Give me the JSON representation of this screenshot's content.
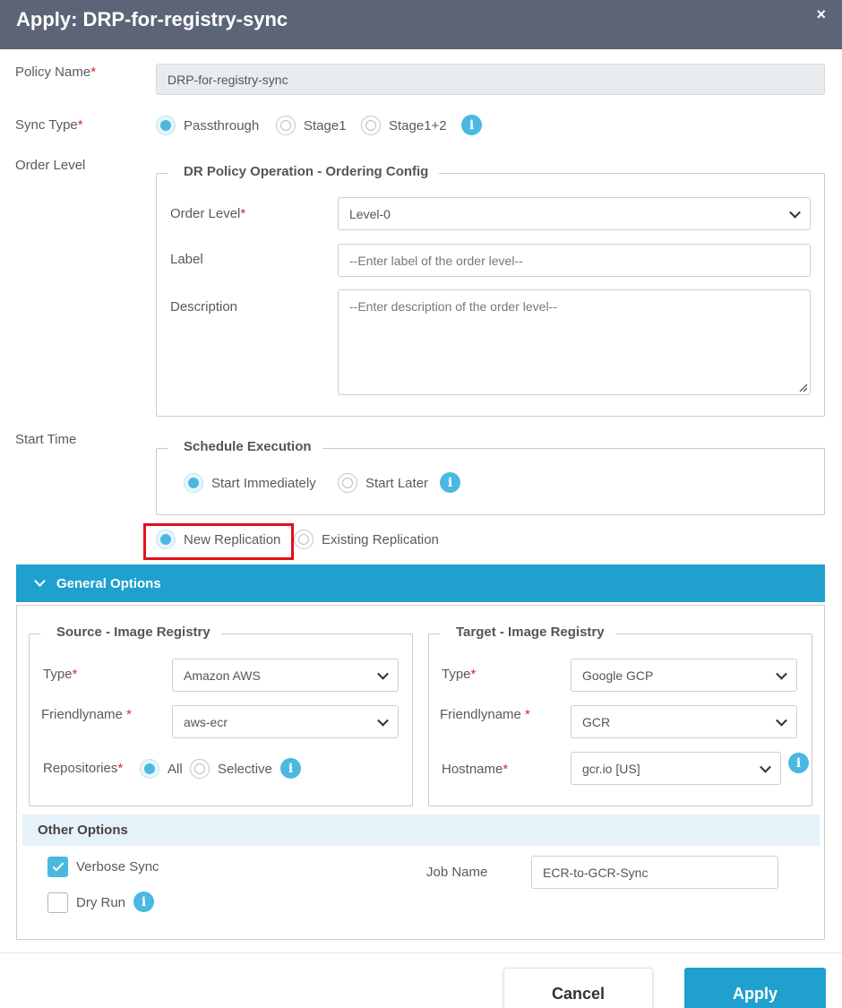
{
  "dialog": {
    "title": "Apply: DRP-for-registry-sync",
    "close_symbol": "×"
  },
  "policy_name": {
    "label": "Policy Name",
    "required": "*",
    "value": "DRP-for-registry-sync"
  },
  "sync_type": {
    "label": "Sync Type",
    "required": "*",
    "options": [
      {
        "label": "Passthrough",
        "selected": true
      },
      {
        "label": "Stage1",
        "selected": false
      },
      {
        "label": "Stage1+2",
        "selected": false
      }
    ]
  },
  "order_level_section": {
    "label": "Order Level",
    "legend": "DR Policy Operation - Ordering Config",
    "order_level": {
      "label": "Order Level",
      "required": "*",
      "value": "Level-0"
    },
    "label_field": {
      "label": "Label",
      "placeholder": "--Enter label of the order level--"
    },
    "description_field": {
      "label": "Description",
      "placeholder": "--Enter description of the order level--"
    }
  },
  "start_time": {
    "label": "Start Time",
    "legend": "Schedule Execution",
    "options": [
      {
        "label": "Start Immediately",
        "selected": true
      },
      {
        "label": "Start Later",
        "selected": false
      }
    ]
  },
  "replication": {
    "options": [
      {
        "label": "New Replication",
        "selected": true
      },
      {
        "label": "Existing Replication",
        "selected": false
      }
    ]
  },
  "general_options": {
    "title": "General Options"
  },
  "source": {
    "legend": "Source - Image Registry",
    "type": {
      "label": "Type",
      "required": "*",
      "value": "Amazon AWS"
    },
    "friendlyname": {
      "label": "Friendlyname",
      "required": "*",
      "value": "aws-ecr"
    },
    "repositories": {
      "label": "Repositories",
      "required": "*",
      "options": [
        {
          "label": "All",
          "selected": true
        },
        {
          "label": "Selective",
          "selected": false
        }
      ]
    }
  },
  "target": {
    "legend": "Target - Image Registry",
    "type": {
      "label": "Type",
      "required": "*",
      "value": "Google GCP"
    },
    "friendlyname": {
      "label": "Friendlyname",
      "required": "*",
      "value": "GCR"
    },
    "hostname": {
      "label": "Hostname",
      "required": "*",
      "value": "gcr.io [US]"
    }
  },
  "other_options": {
    "title": "Other Options",
    "verbose_sync": {
      "label": "Verbose Sync",
      "checked": true
    },
    "dry_run": {
      "label": "Dry Run",
      "checked": false
    },
    "job_name": {
      "label": "Job Name",
      "value": "ECR-to-GCR-Sync"
    }
  },
  "footer": {
    "cancel_label": "Cancel",
    "apply_label": "Apply"
  },
  "colors": {
    "header": "#5c6478",
    "accent": "#1fa0cf",
    "radio_accent": "#4ab8e0",
    "highlight": "#e0101b",
    "required": "#e02424"
  },
  "icons": [
    "close-icon",
    "info-icon",
    "chevron-down-icon",
    "check-icon"
  ]
}
